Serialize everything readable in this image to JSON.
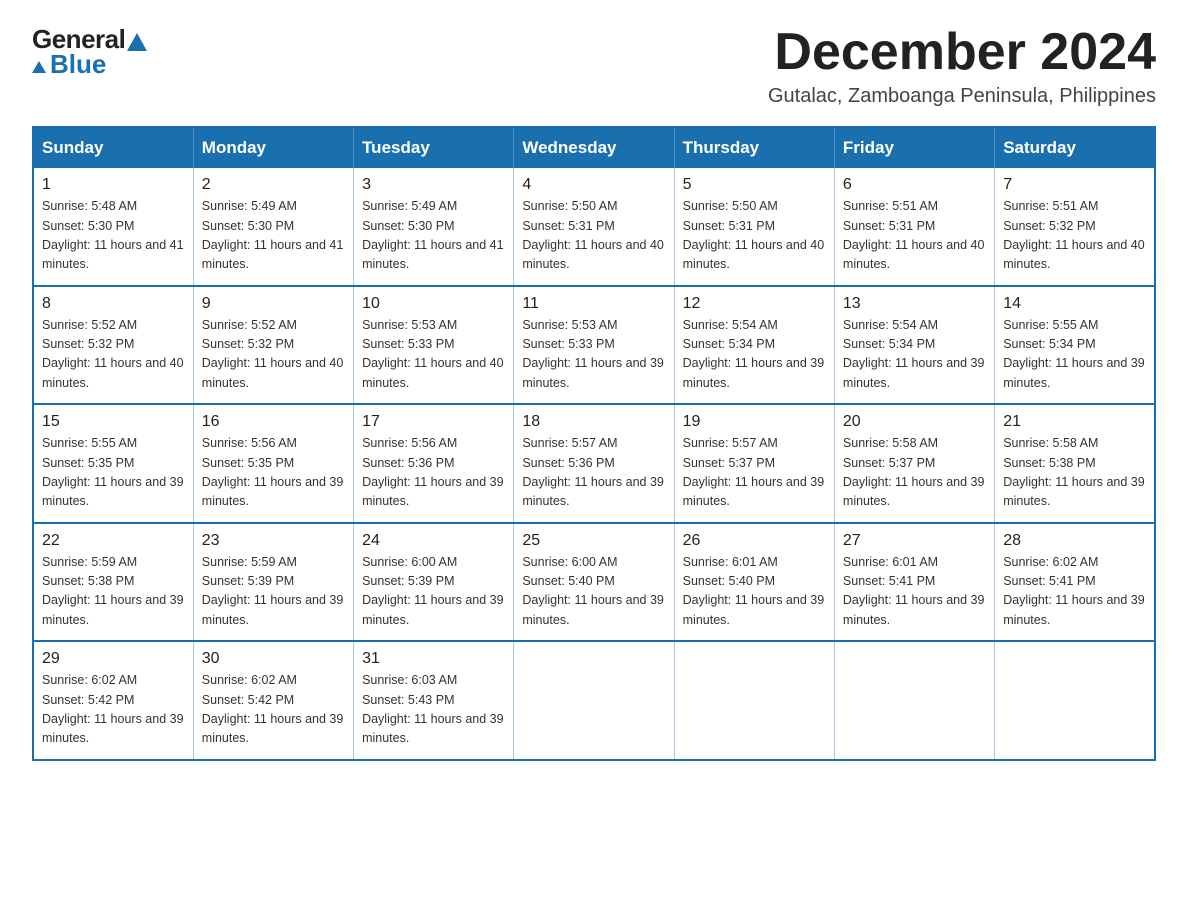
{
  "logo": {
    "general": "General",
    "blue": "Blue"
  },
  "header": {
    "month": "December 2024",
    "location": "Gutalac, Zamboanga Peninsula, Philippines"
  },
  "weekdays": [
    "Sunday",
    "Monday",
    "Tuesday",
    "Wednesday",
    "Thursday",
    "Friday",
    "Saturday"
  ],
  "weeks": [
    [
      {
        "day": "1",
        "sunrise": "5:48 AM",
        "sunset": "5:30 PM",
        "daylight": "11 hours and 41 minutes."
      },
      {
        "day": "2",
        "sunrise": "5:49 AM",
        "sunset": "5:30 PM",
        "daylight": "11 hours and 41 minutes."
      },
      {
        "day": "3",
        "sunrise": "5:49 AM",
        "sunset": "5:30 PM",
        "daylight": "11 hours and 41 minutes."
      },
      {
        "day": "4",
        "sunrise": "5:50 AM",
        "sunset": "5:31 PM",
        "daylight": "11 hours and 40 minutes."
      },
      {
        "day": "5",
        "sunrise": "5:50 AM",
        "sunset": "5:31 PM",
        "daylight": "11 hours and 40 minutes."
      },
      {
        "day": "6",
        "sunrise": "5:51 AM",
        "sunset": "5:31 PM",
        "daylight": "11 hours and 40 minutes."
      },
      {
        "day": "7",
        "sunrise": "5:51 AM",
        "sunset": "5:32 PM",
        "daylight": "11 hours and 40 minutes."
      }
    ],
    [
      {
        "day": "8",
        "sunrise": "5:52 AM",
        "sunset": "5:32 PM",
        "daylight": "11 hours and 40 minutes."
      },
      {
        "day": "9",
        "sunrise": "5:52 AM",
        "sunset": "5:32 PM",
        "daylight": "11 hours and 40 minutes."
      },
      {
        "day": "10",
        "sunrise": "5:53 AM",
        "sunset": "5:33 PM",
        "daylight": "11 hours and 40 minutes."
      },
      {
        "day": "11",
        "sunrise": "5:53 AM",
        "sunset": "5:33 PM",
        "daylight": "11 hours and 39 minutes."
      },
      {
        "day": "12",
        "sunrise": "5:54 AM",
        "sunset": "5:34 PM",
        "daylight": "11 hours and 39 minutes."
      },
      {
        "day": "13",
        "sunrise": "5:54 AM",
        "sunset": "5:34 PM",
        "daylight": "11 hours and 39 minutes."
      },
      {
        "day": "14",
        "sunrise": "5:55 AM",
        "sunset": "5:34 PM",
        "daylight": "11 hours and 39 minutes."
      }
    ],
    [
      {
        "day": "15",
        "sunrise": "5:55 AM",
        "sunset": "5:35 PM",
        "daylight": "11 hours and 39 minutes."
      },
      {
        "day": "16",
        "sunrise": "5:56 AM",
        "sunset": "5:35 PM",
        "daylight": "11 hours and 39 minutes."
      },
      {
        "day": "17",
        "sunrise": "5:56 AM",
        "sunset": "5:36 PM",
        "daylight": "11 hours and 39 minutes."
      },
      {
        "day": "18",
        "sunrise": "5:57 AM",
        "sunset": "5:36 PM",
        "daylight": "11 hours and 39 minutes."
      },
      {
        "day": "19",
        "sunrise": "5:57 AM",
        "sunset": "5:37 PM",
        "daylight": "11 hours and 39 minutes."
      },
      {
        "day": "20",
        "sunrise": "5:58 AM",
        "sunset": "5:37 PM",
        "daylight": "11 hours and 39 minutes."
      },
      {
        "day": "21",
        "sunrise": "5:58 AM",
        "sunset": "5:38 PM",
        "daylight": "11 hours and 39 minutes."
      }
    ],
    [
      {
        "day": "22",
        "sunrise": "5:59 AM",
        "sunset": "5:38 PM",
        "daylight": "11 hours and 39 minutes."
      },
      {
        "day": "23",
        "sunrise": "5:59 AM",
        "sunset": "5:39 PM",
        "daylight": "11 hours and 39 minutes."
      },
      {
        "day": "24",
        "sunrise": "6:00 AM",
        "sunset": "5:39 PM",
        "daylight": "11 hours and 39 minutes."
      },
      {
        "day": "25",
        "sunrise": "6:00 AM",
        "sunset": "5:40 PM",
        "daylight": "11 hours and 39 minutes."
      },
      {
        "day": "26",
        "sunrise": "6:01 AM",
        "sunset": "5:40 PM",
        "daylight": "11 hours and 39 minutes."
      },
      {
        "day": "27",
        "sunrise": "6:01 AM",
        "sunset": "5:41 PM",
        "daylight": "11 hours and 39 minutes."
      },
      {
        "day": "28",
        "sunrise": "6:02 AM",
        "sunset": "5:41 PM",
        "daylight": "11 hours and 39 minutes."
      }
    ],
    [
      {
        "day": "29",
        "sunrise": "6:02 AM",
        "sunset": "5:42 PM",
        "daylight": "11 hours and 39 minutes."
      },
      {
        "day": "30",
        "sunrise": "6:02 AM",
        "sunset": "5:42 PM",
        "daylight": "11 hours and 39 minutes."
      },
      {
        "day": "31",
        "sunrise": "6:03 AM",
        "sunset": "5:43 PM",
        "daylight": "11 hours and 39 minutes."
      },
      null,
      null,
      null,
      null
    ]
  ]
}
